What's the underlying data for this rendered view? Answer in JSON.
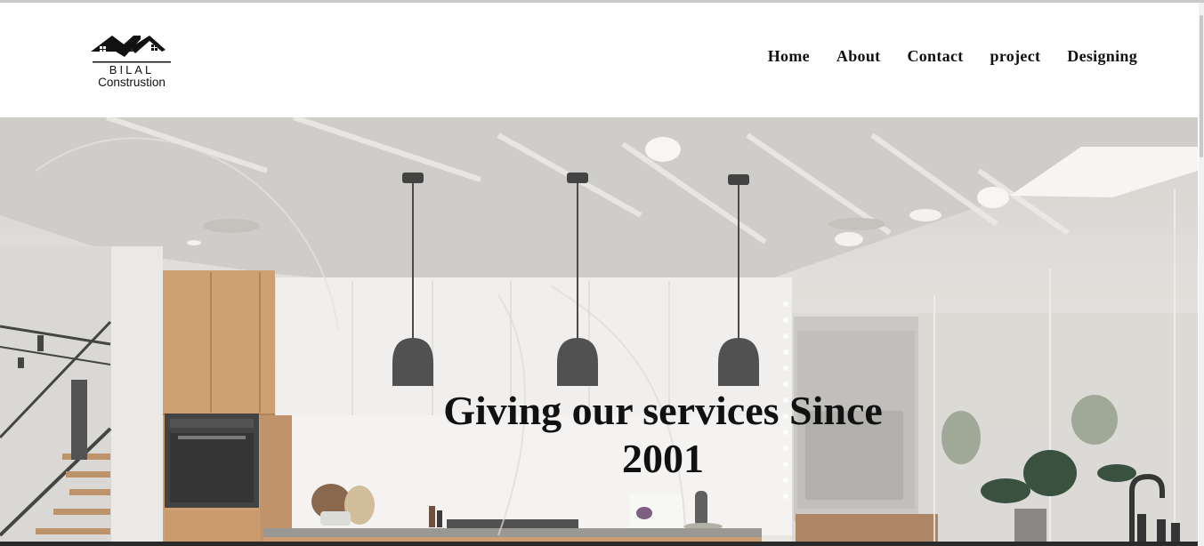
{
  "brand": {
    "name": "BILAL",
    "tagline": "Construstion"
  },
  "nav": {
    "items": [
      {
        "label": "Home"
      },
      {
        "label": "About"
      },
      {
        "label": "Contact"
      },
      {
        "label": "project"
      },
      {
        "label": "Designing"
      }
    ]
  },
  "hero": {
    "title_line1": "Giving our services Since",
    "title_line2": "2001"
  },
  "colors": {
    "text": "#111111",
    "background": "#ffffff",
    "cabinet_wood": "#c8935f"
  }
}
